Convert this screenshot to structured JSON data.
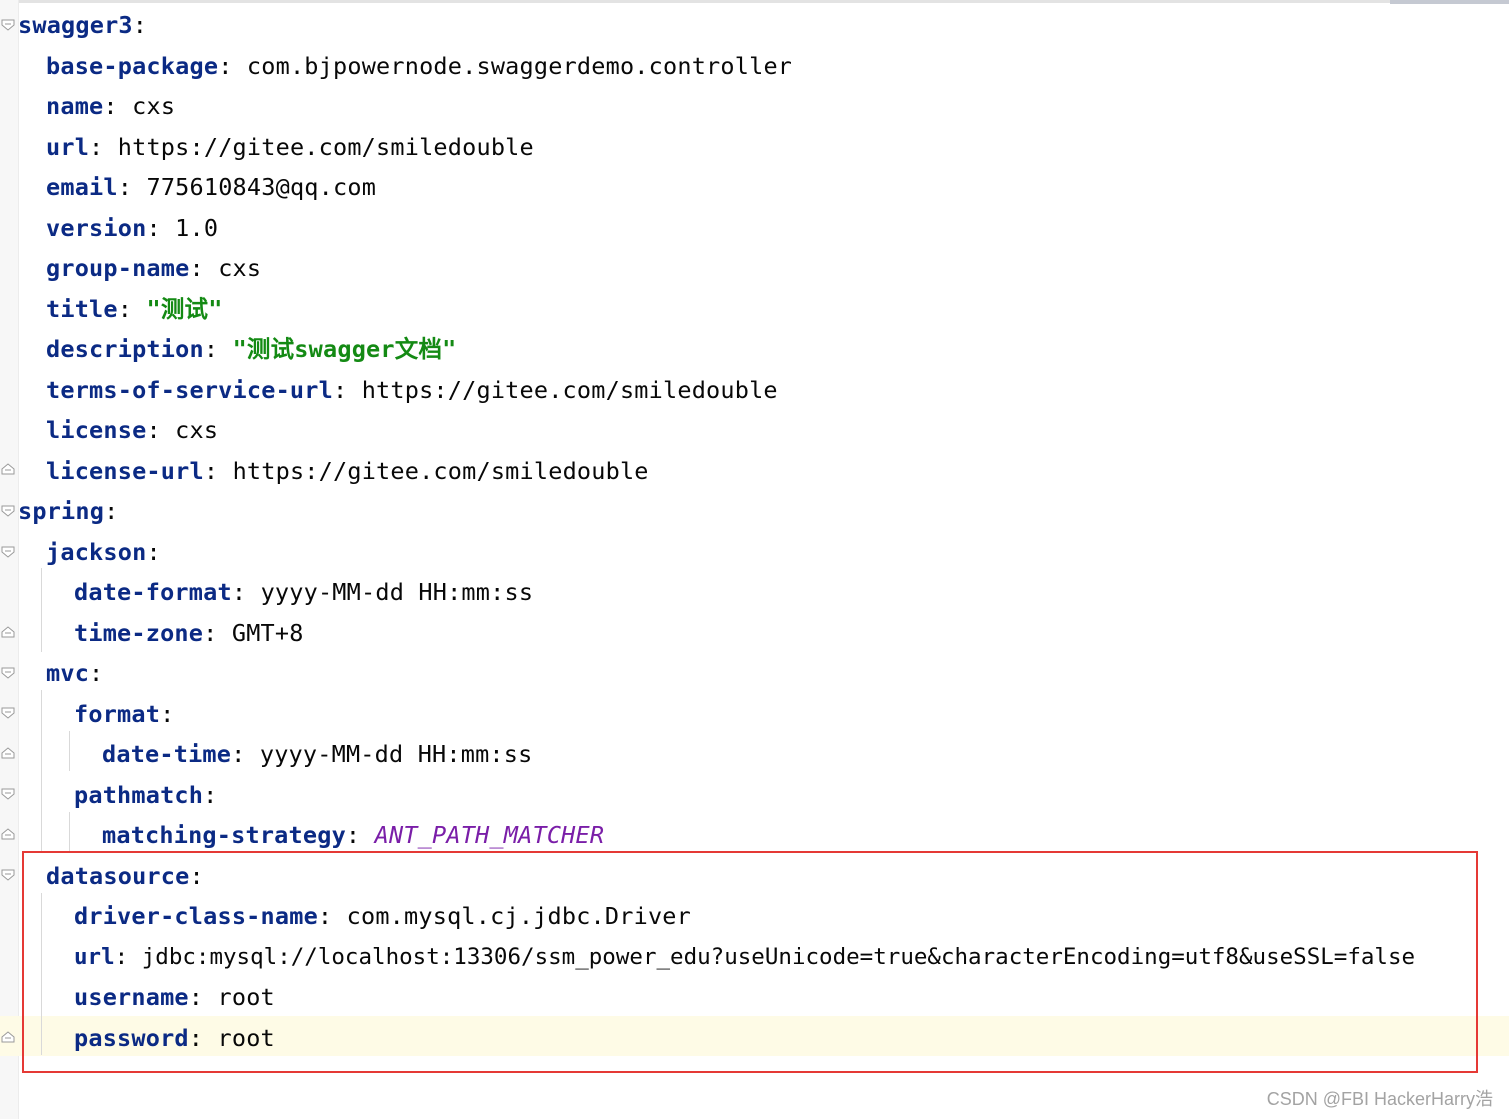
{
  "lines": [
    {
      "key": "swagger3",
      "value": ""
    },
    {
      "key": "base-package",
      "value": "com.bjpowernode.swaggerdemo.controller"
    },
    {
      "key": "name",
      "value": "cxs"
    },
    {
      "key": "url",
      "value": "https://gitee.com/smiledouble"
    },
    {
      "key": "email",
      "value": "775610843@qq.com"
    },
    {
      "key": "version",
      "value": "1.0"
    },
    {
      "key": "group-name",
      "value": "cxs"
    },
    {
      "key": "title",
      "value": "\"测试\""
    },
    {
      "key": "description",
      "value": "\"测试swagger文档\""
    },
    {
      "key": "terms-of-service-url",
      "value": "https://gitee.com/smiledouble"
    },
    {
      "key": "license",
      "value": "cxs"
    },
    {
      "key": "license-url",
      "value": "https://gitee.com/smiledouble"
    },
    {
      "key": "spring",
      "value": ""
    },
    {
      "key": "jackson",
      "value": ""
    },
    {
      "key": "date-format",
      "value": "yyyy-MM-dd HH:mm:ss"
    },
    {
      "key": "time-zone",
      "value": "GMT+8"
    },
    {
      "key": "mvc",
      "value": ""
    },
    {
      "key": "format",
      "value": ""
    },
    {
      "key": "date-time",
      "value": "yyyy-MM-dd HH:mm:ss"
    },
    {
      "key": "pathmatch",
      "value": ""
    },
    {
      "key": "matching-strategy",
      "value": "ANT_PATH_MATCHER"
    },
    {
      "key": "datasource",
      "value": ""
    },
    {
      "key": "driver-class-name",
      "value": "com.mysql.cj.jdbc.Driver"
    },
    {
      "key": "url",
      "value": "jdbc:mysql://localhost:13306/ssm_power_edu?useUnicode=true&characterEncoding=utf8&useSSL=false"
    },
    {
      "key": "username",
      "value": "root"
    },
    {
      "key": "password",
      "value": "root"
    }
  ],
  "separator": ":",
  "colors": {
    "key": "#0b2a84",
    "string": "#148a14",
    "enum": "#7a1ea8",
    "highlight_border": "#e53935",
    "caret_row": "#fefbe6"
  },
  "watermark": "CSDN @FBI HackerHarry浩"
}
